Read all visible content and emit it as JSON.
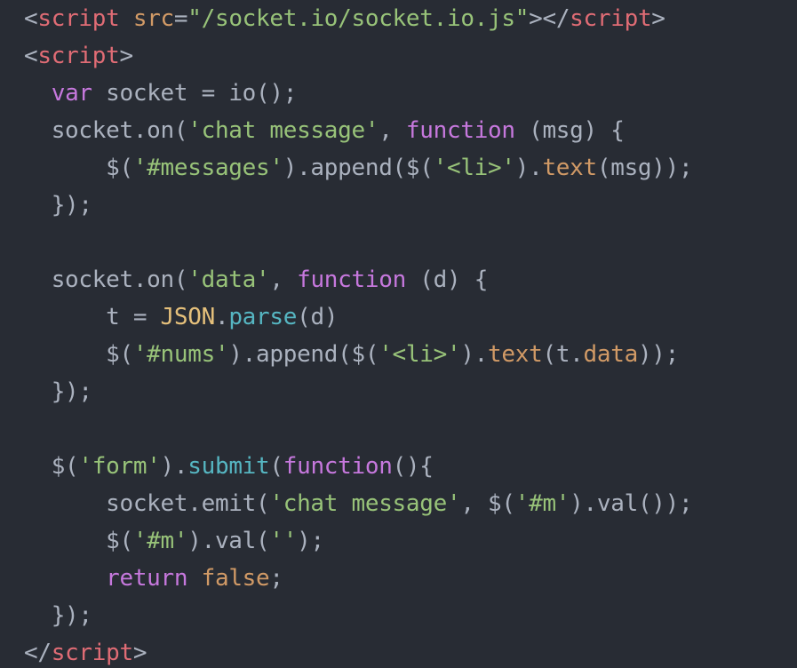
{
  "colors": {
    "background": "#282c34",
    "plain": "#abb2bf",
    "tag": "#e06c75",
    "attr": "#d19a66",
    "string": "#98c379",
    "keyword": "#c678dd",
    "method": "#56b6c2",
    "prop": "#d19a66",
    "builtin": "#e5c07b"
  },
  "lines": [
    [
      {
        "t": "<",
        "k": "punct"
      },
      {
        "t": "script",
        "k": "tag"
      },
      {
        "t": " ",
        "k": "plain"
      },
      {
        "t": "src",
        "k": "attr"
      },
      {
        "t": "=",
        "k": "plain"
      },
      {
        "t": "\"/socket.io/socket.io.js\"",
        "k": "string"
      },
      {
        "t": "></",
        "k": "punct"
      },
      {
        "t": "script",
        "k": "tag"
      },
      {
        "t": ">",
        "k": "punct"
      }
    ],
    [
      {
        "t": "<",
        "k": "punct"
      },
      {
        "t": "script",
        "k": "tag"
      },
      {
        "t": ">",
        "k": "punct"
      }
    ],
    [
      {
        "t": "  ",
        "k": "plain"
      },
      {
        "t": "var",
        "k": "keyword"
      },
      {
        "t": " socket = io();",
        "k": "plain"
      }
    ],
    [
      {
        "t": "  socket.on(",
        "k": "plain"
      },
      {
        "t": "'chat message'",
        "k": "string"
      },
      {
        "t": ", ",
        "k": "plain"
      },
      {
        "t": "function",
        "k": "keyword"
      },
      {
        "t": " (msg) {",
        "k": "plain"
      }
    ],
    [
      {
        "t": "      $(",
        "k": "plain"
      },
      {
        "t": "'#messages'",
        "k": "string"
      },
      {
        "t": ").append($(",
        "k": "plain"
      },
      {
        "t": "'<li>'",
        "k": "string"
      },
      {
        "t": ").",
        "k": "plain"
      },
      {
        "t": "text",
        "k": "prop"
      },
      {
        "t": "(msg));",
        "k": "plain"
      }
    ],
    [
      {
        "t": "  });",
        "k": "plain"
      }
    ],
    [
      {
        "t": "",
        "k": "plain"
      }
    ],
    [
      {
        "t": "  socket.on(",
        "k": "plain"
      },
      {
        "t": "'data'",
        "k": "string"
      },
      {
        "t": ", ",
        "k": "plain"
      },
      {
        "t": "function",
        "k": "keyword"
      },
      {
        "t": " (d) {",
        "k": "plain"
      }
    ],
    [
      {
        "t": "      t = ",
        "k": "plain"
      },
      {
        "t": "JSON",
        "k": "builtin"
      },
      {
        "t": ".",
        "k": "plain"
      },
      {
        "t": "parse",
        "k": "method"
      },
      {
        "t": "(d)",
        "k": "plain"
      }
    ],
    [
      {
        "t": "      $(",
        "k": "plain"
      },
      {
        "t": "'#nums'",
        "k": "string"
      },
      {
        "t": ").append($(",
        "k": "plain"
      },
      {
        "t": "'<li>'",
        "k": "string"
      },
      {
        "t": ").",
        "k": "plain"
      },
      {
        "t": "text",
        "k": "prop"
      },
      {
        "t": "(t.",
        "k": "plain"
      },
      {
        "t": "data",
        "k": "prop"
      },
      {
        "t": "));",
        "k": "plain"
      }
    ],
    [
      {
        "t": "  });",
        "k": "plain"
      }
    ],
    [
      {
        "t": "",
        "k": "plain"
      }
    ],
    [
      {
        "t": "  $(",
        "k": "plain"
      },
      {
        "t": "'form'",
        "k": "string"
      },
      {
        "t": ").",
        "k": "plain"
      },
      {
        "t": "submit",
        "k": "method"
      },
      {
        "t": "(",
        "k": "plain"
      },
      {
        "t": "function",
        "k": "keyword"
      },
      {
        "t": "(){",
        "k": "plain"
      }
    ],
    [
      {
        "t": "      socket.emit(",
        "k": "plain"
      },
      {
        "t": "'chat message'",
        "k": "string"
      },
      {
        "t": ", $(",
        "k": "plain"
      },
      {
        "t": "'#m'",
        "k": "string"
      },
      {
        "t": ").val());",
        "k": "plain"
      }
    ],
    [
      {
        "t": "      $(",
        "k": "plain"
      },
      {
        "t": "'#m'",
        "k": "string"
      },
      {
        "t": ").val(",
        "k": "plain"
      },
      {
        "t": "''",
        "k": "string"
      },
      {
        "t": ");",
        "k": "plain"
      }
    ],
    [
      {
        "t": "      ",
        "k": "plain"
      },
      {
        "t": "return",
        "k": "keyword"
      },
      {
        "t": " ",
        "k": "plain"
      },
      {
        "t": "false",
        "k": "attr"
      },
      {
        "t": ";",
        "k": "plain"
      }
    ],
    [
      {
        "t": "  });",
        "k": "plain"
      }
    ],
    [
      {
        "t": "</",
        "k": "punct"
      },
      {
        "t": "script",
        "k": "tag"
      },
      {
        "t": ">",
        "k": "punct"
      }
    ]
  ]
}
